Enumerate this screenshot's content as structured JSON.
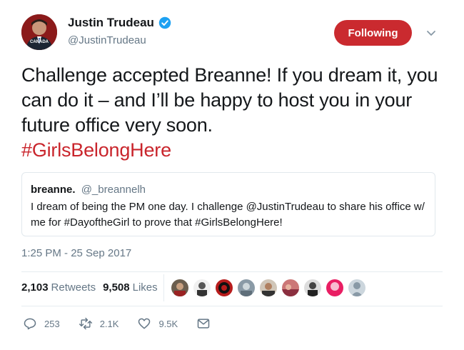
{
  "author": {
    "display_name": "Justin Trudeau",
    "handle": "@JustinTrudeau",
    "avatar_icon": "profile-avatar",
    "avatar_badge_text": "CANADA",
    "verified_icon": "verified-badge-icon"
  },
  "follow_button": {
    "label": "Following"
  },
  "menu": {
    "icon": "chevron-down-icon"
  },
  "tweet": {
    "text": "Challenge accepted Breanne! If you dream it, you can do it – and I’ll be happy to host you in your future office very soon.",
    "hashtag": "#GirlsBelongHere"
  },
  "quoted_tweet": {
    "display_name": "breanne.",
    "handle": "@_breannelh",
    "text": "I dream of being the PM one day. I challenge @JustinTrudeau to share his office w/ me for #DayoftheGirl to prove that #GirlsBelongHere!"
  },
  "timestamp": "1:25 PM - 25 Sep 2017",
  "stats": {
    "retweets_count": "2,103",
    "retweets_label": "Retweets",
    "likes_count": "9,508",
    "likes_label": "Likes"
  },
  "actions": {
    "reply_count": "253",
    "retweet_count": "2.1K",
    "like_count": "9.5K",
    "message_icon": "envelope-icon"
  },
  "colors": {
    "accent": "#ca2a2f",
    "hashtag": "#c9252c",
    "muted": "#657786",
    "verified": "#1da1f2"
  }
}
